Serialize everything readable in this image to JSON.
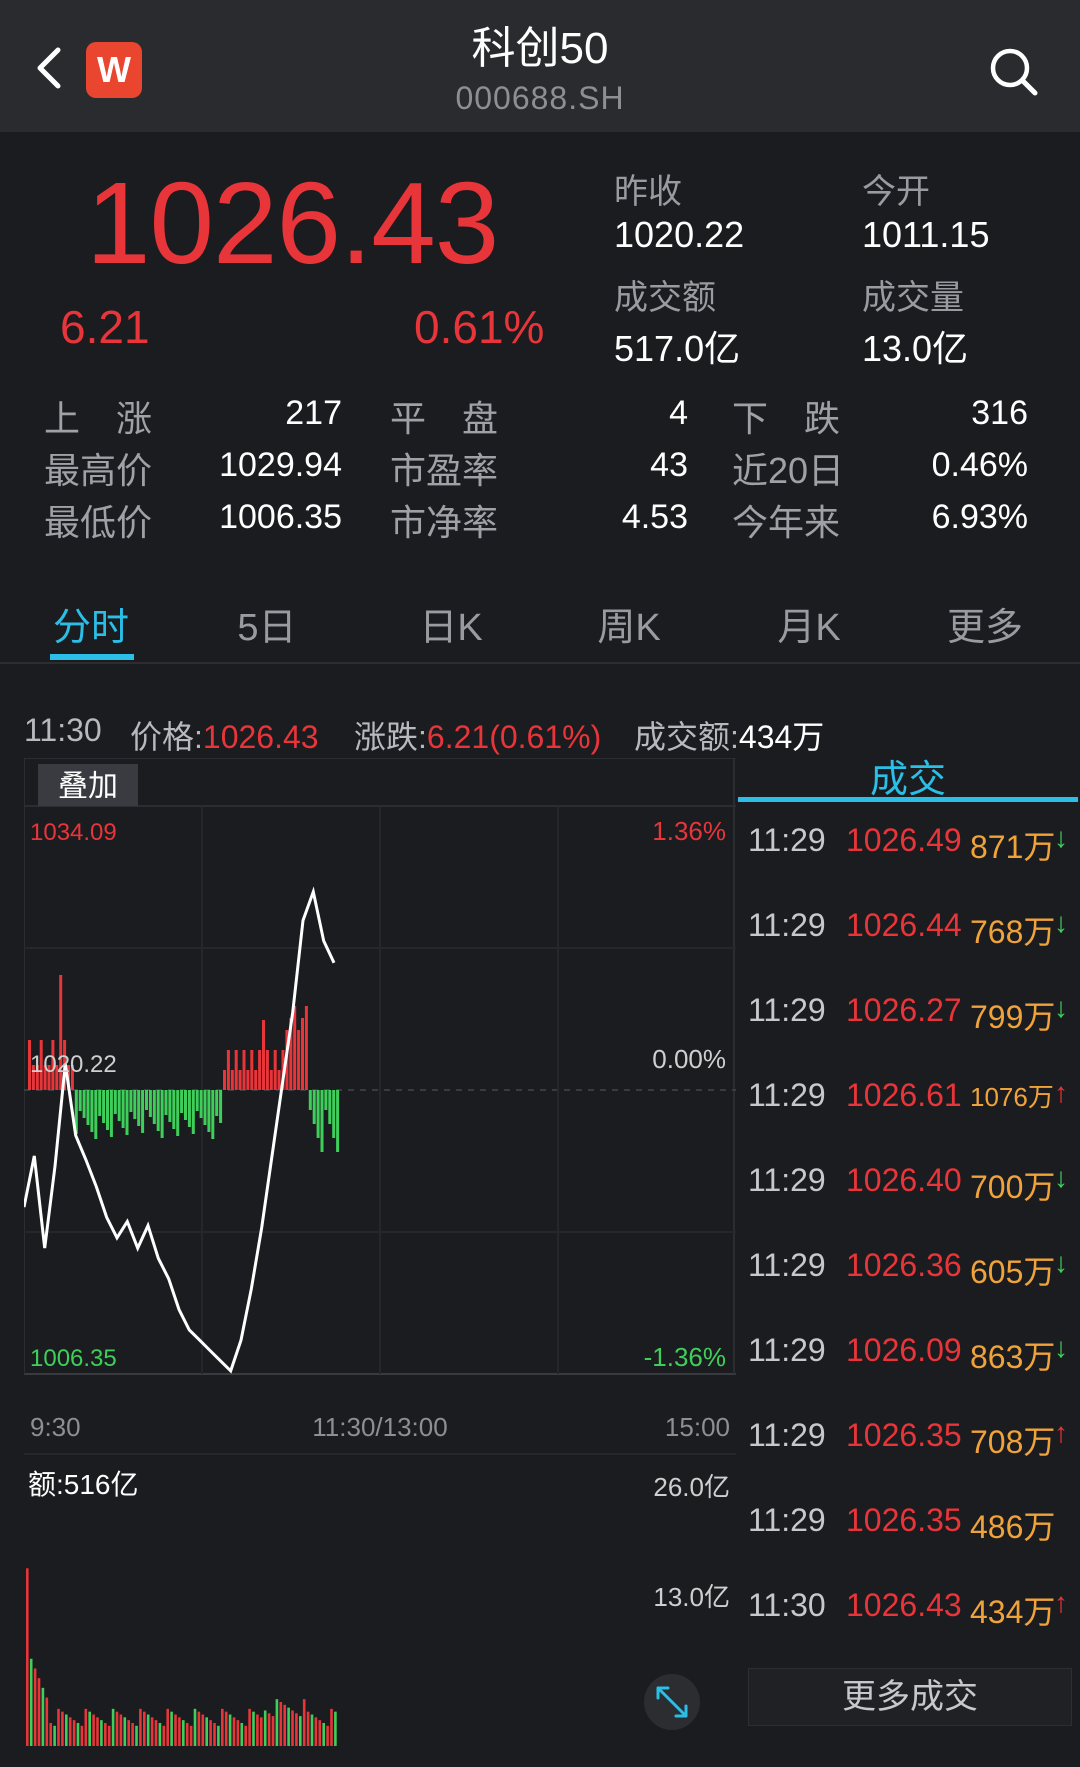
{
  "header": {
    "title": "科创50",
    "code": "000688.SH",
    "logo_text": "W"
  },
  "quote": {
    "price": "1026.43",
    "change": "6.21",
    "change_pct": "0.61%",
    "prev_close_label": "昨收",
    "prev_close": "1020.22",
    "open_label": "今开",
    "open": "1011.15",
    "turnover_label": "成交额",
    "turnover": "517.0亿",
    "volume_label": "成交量",
    "volume": "13.0亿"
  },
  "stats": {
    "rise_label": "上　涨",
    "rise": "217",
    "flat_label": "平　盘",
    "flat": "4",
    "fall_label": "下　跌",
    "fall": "316",
    "high_label": "最高价",
    "high": "1029.94",
    "pe_label": "市盈率",
    "pe": "43",
    "d20_label": "近20日",
    "d20": "0.46%",
    "low_label": "最低价",
    "low": "1006.35",
    "pb_label": "市净率",
    "pb": "4.53",
    "ytd_label": "今年来",
    "ytd": "6.93%"
  },
  "tabs": [
    {
      "label": "分时",
      "active": true
    },
    {
      "label": "5日"
    },
    {
      "label": "日K"
    },
    {
      "label": "周K"
    },
    {
      "label": "月K"
    },
    {
      "label": "更多"
    }
  ],
  "info_line": {
    "time": "11:30",
    "price_label": "价格:",
    "price": "1026.43",
    "change_label": "涨跌:",
    "change": "6.21(0.61%)",
    "amount_label": "成交额:",
    "amount": "434万"
  },
  "chart": {
    "overlay_button": "叠加",
    "y_top": "1034.09",
    "y_mid": "1020.22",
    "y_bottom": "1006.35",
    "pct_top": "1.36%",
    "pct_mid": "0.00%",
    "pct_bottom": "-1.36%",
    "x_start": "9:30",
    "x_mid": "11:30/13:00",
    "x_end": "15:00",
    "amount_label": "额:516亿",
    "vol_top": "26.0亿",
    "vol_mid": "13.0亿",
    "colors": {
      "up": "#e8353a",
      "down": "#3ecf5a",
      "line": "#ffffff",
      "accent": "#2bbfe8"
    }
  },
  "chart_data": {
    "type": "line",
    "x_range": [
      "9:30",
      "15:00"
    ],
    "ylim": [
      1006.35,
      1034.09
    ],
    "reference": 1020.22,
    "price_line": [
      1014.5,
      1017.0,
      1012.5,
      1016.5,
      1021.5,
      1018.0,
      1016.8,
      1015.5,
      1014.0,
      1013.0,
      1013.8,
      1012.5,
      1013.6,
      1012.0,
      1011.0,
      1009.5,
      1008.5,
      1008.0,
      1007.5,
      1007.0,
      1006.5,
      1008.0,
      1010.5,
      1013.5,
      1017.0,
      1020.5,
      1024.0,
      1028.5,
      1029.9,
      1027.5,
      1026.43
    ],
    "volume_range": [
      0,
      26.0
    ],
    "volume_unit": "亿"
  },
  "trades": {
    "header": "成交",
    "more_label": "更多成交",
    "rows": [
      {
        "time": "11:29",
        "price": "1026.49",
        "vol": "871万",
        "dir": "down",
        "arrow": "↓"
      },
      {
        "time": "11:29",
        "price": "1026.44",
        "vol": "768万",
        "dir": "down",
        "arrow": "↓"
      },
      {
        "time": "11:29",
        "price": "1026.27",
        "vol": "799万",
        "dir": "down",
        "arrow": "↓"
      },
      {
        "time": "11:29",
        "price": "1026.61",
        "vol": "1076万",
        "dir": "up",
        "arrow": "↑"
      },
      {
        "time": "11:29",
        "price": "1026.40",
        "vol": "700万",
        "dir": "down",
        "arrow": "↓"
      },
      {
        "time": "11:29",
        "price": "1026.36",
        "vol": "605万",
        "dir": "down",
        "arrow": "↓"
      },
      {
        "time": "11:29",
        "price": "1026.09",
        "vol": "863万",
        "dir": "down",
        "arrow": "↓"
      },
      {
        "time": "11:29",
        "price": "1026.35",
        "vol": "708万",
        "dir": "up",
        "arrow": "↑"
      },
      {
        "time": "11:29",
        "price": "1026.35",
        "vol": "486万",
        "dir": "none",
        "arrow": ""
      },
      {
        "time": "11:30",
        "price": "1026.43",
        "vol": "434万",
        "dir": "up",
        "arrow": "↑"
      }
    ]
  }
}
